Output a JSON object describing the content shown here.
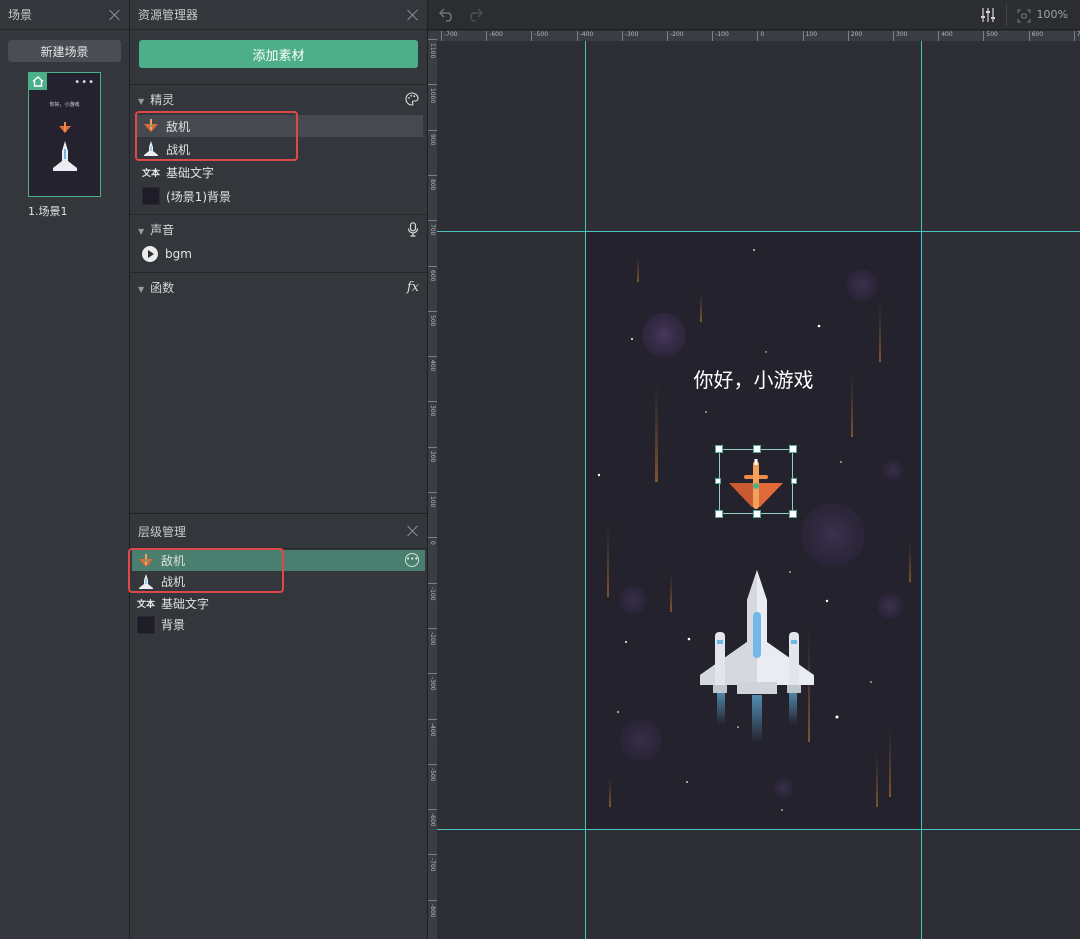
{
  "scene_panel": {
    "title": "场景",
    "new_scene_label": "新建场景",
    "thumbnail_title": "你好，小游戏",
    "scene_name": "1.场景1"
  },
  "asset_panel": {
    "title": "资源管理器",
    "add_button": "添加素材",
    "sprites_section": "精灵",
    "sprites": [
      "敌机",
      "战机",
      "基础文字",
      "(场景1)背景"
    ],
    "text_icon_label": "文本",
    "sound_section": "声音",
    "sounds": [
      "bgm"
    ],
    "functions_section": "函数",
    "functions_icon_text": "fx"
  },
  "layer_panel": {
    "title": "层级管理",
    "layers": [
      "敌机",
      "战机",
      "基础文字",
      "背景"
    ],
    "text_icon_label": "文本"
  },
  "toolbar": {
    "zoom": "100%"
  },
  "ruler": {
    "h_ticks": [
      "-700",
      "-600",
      "-500",
      "-400",
      "-300",
      "-200",
      "-100",
      "0",
      "100",
      "200",
      "300",
      "400",
      "500",
      "600",
      "700"
    ],
    "v_ticks": [
      "1100",
      "1000",
      "900",
      "800",
      "700",
      "600",
      "500",
      "400",
      "300",
      "200",
      "100",
      "0",
      "-100",
      "-200",
      "-300",
      "-400",
      "-500",
      "-600",
      "-700",
      "-800"
    ]
  },
  "stage": {
    "title": "你好，小游戏"
  },
  "colors": {
    "accent": "#4caf8a",
    "guide": "#48c4c2",
    "highlight": "#e04848",
    "stage_bg": "#24222d"
  }
}
